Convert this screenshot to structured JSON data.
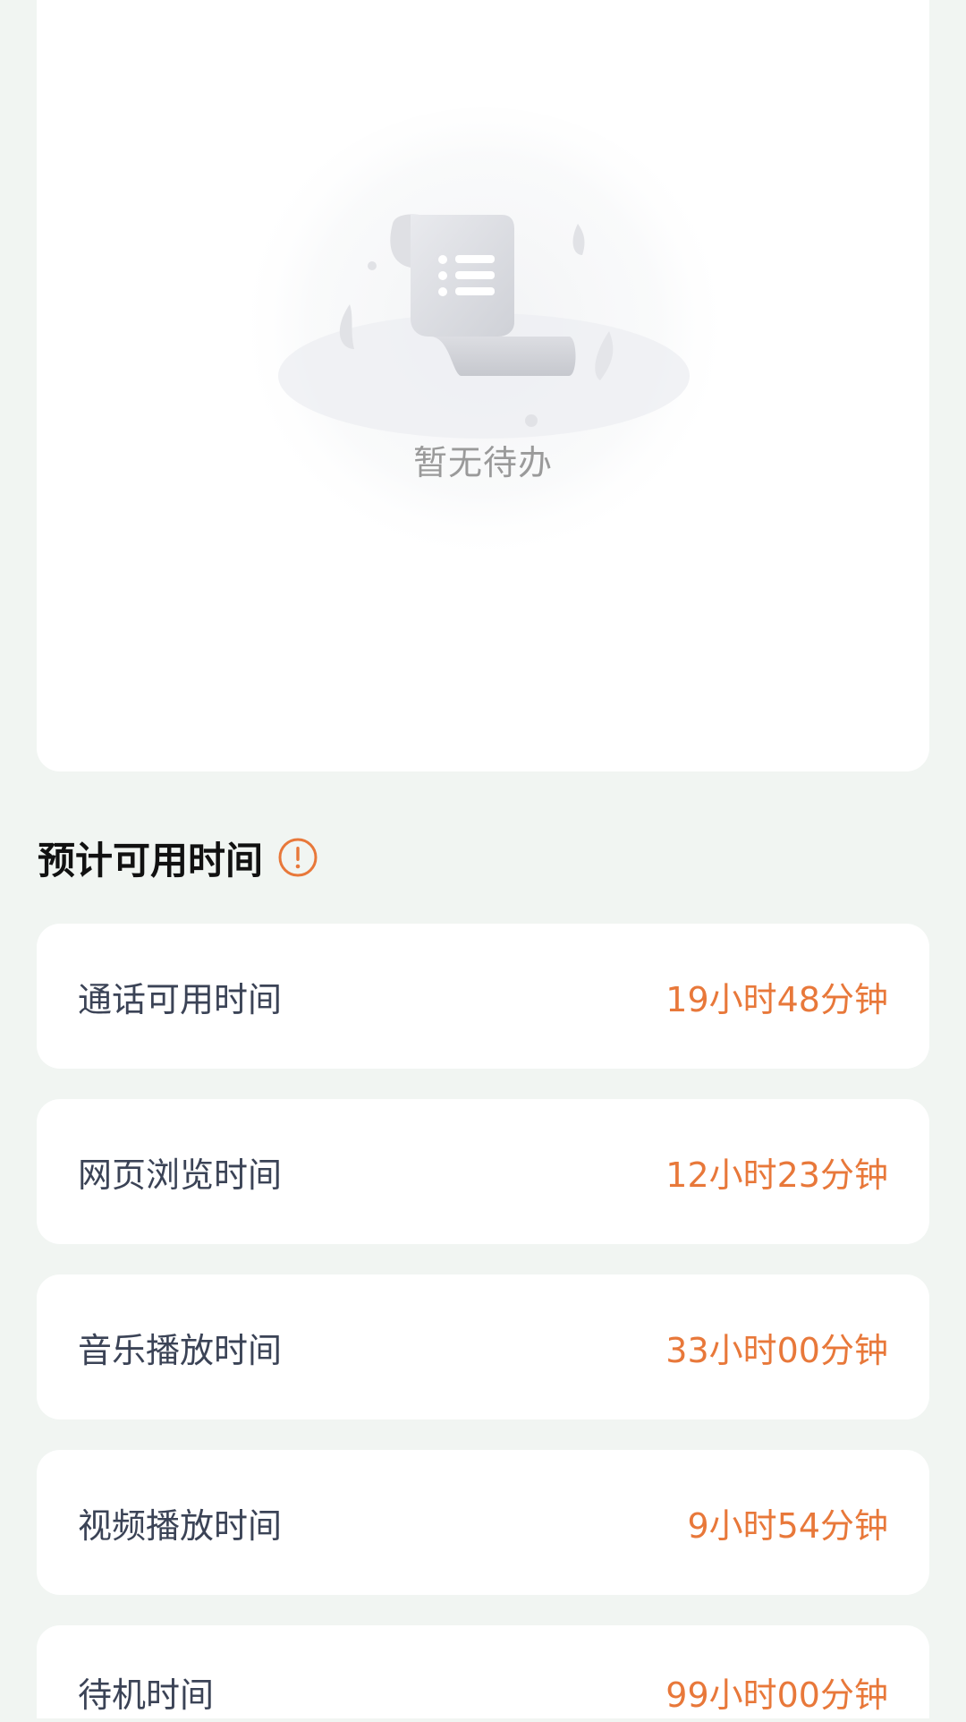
{
  "todo": {
    "empty_text": "暂无待办"
  },
  "estimate": {
    "title": "预计可用时间",
    "info_icon": "info-circle-icon",
    "accent_color": "#e8783a",
    "rows": [
      {
        "label": "通话可用时间",
        "value": "19小时48分钟"
      },
      {
        "label": "网页浏览时间",
        "value": "12小时23分钟"
      },
      {
        "label": "音乐播放时间",
        "value": "33小时00分钟"
      },
      {
        "label": "视频播放时间",
        "value": "9小时54分钟"
      },
      {
        "label": "待机时间",
        "value": "99小时00分钟"
      }
    ]
  }
}
